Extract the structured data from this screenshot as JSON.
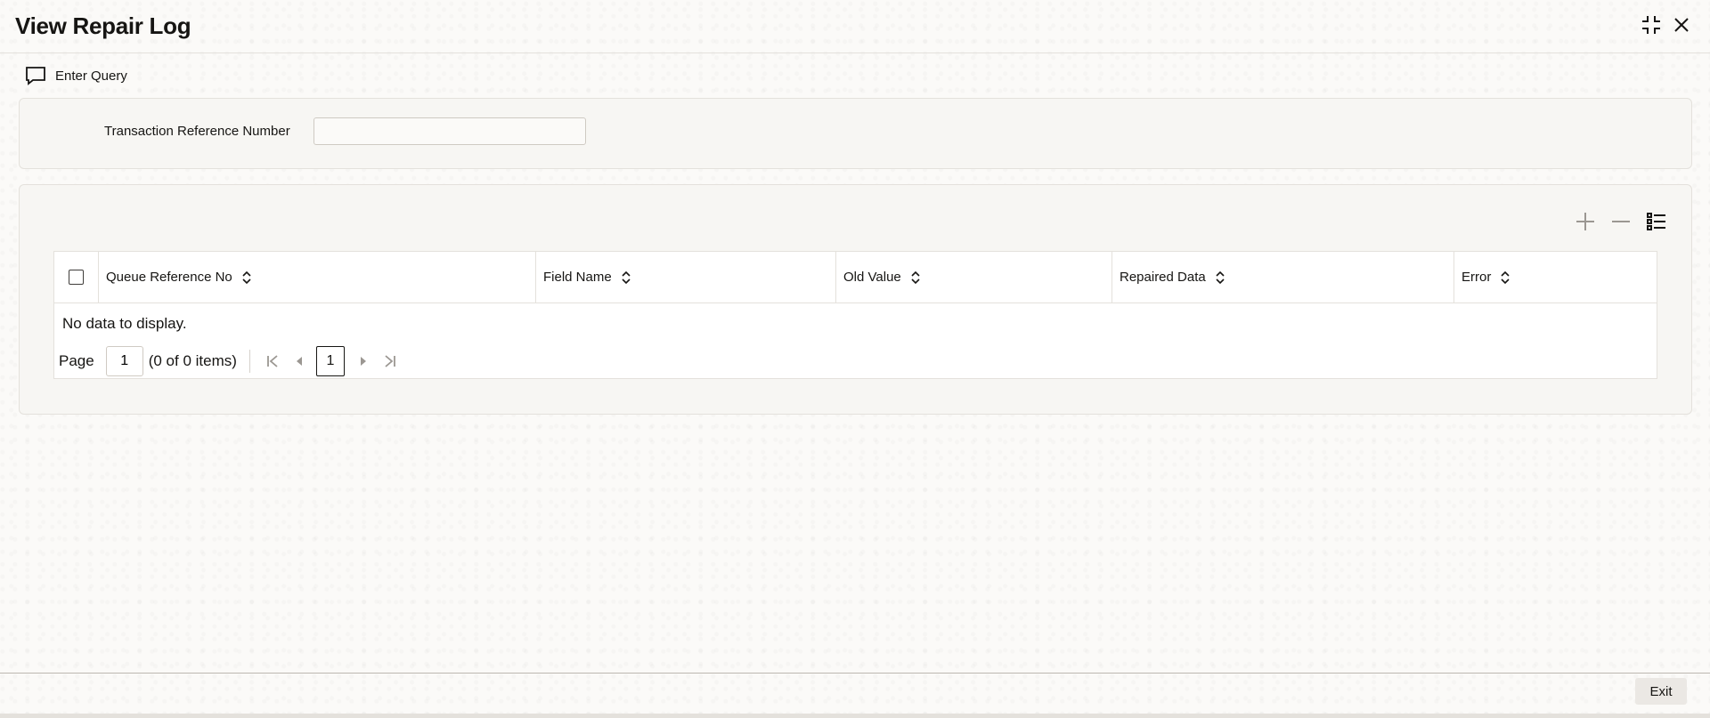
{
  "header": {
    "title": "View Repair Log",
    "maximize_icon": "collapse-icon",
    "close_icon": "close-icon"
  },
  "toolbar": {
    "enter_query_label": "Enter Query",
    "enter_query_icon": "chat-bubble-icon"
  },
  "query_form": {
    "transaction_reference_label": "Transaction Reference Number",
    "transaction_reference_value": ""
  },
  "grid": {
    "tools": [
      "add-icon",
      "remove-icon",
      "list-icon"
    ],
    "columns": [
      {
        "label": "Queue Reference No"
      },
      {
        "label": "Field Name"
      },
      {
        "label": "Old Value"
      },
      {
        "label": "Repaired Data"
      },
      {
        "label": "Error"
      }
    ],
    "rows": [],
    "empty_message": "No data to display."
  },
  "pagination": {
    "page_label": "Page",
    "page_value": "1",
    "items_text": "(0 of 0 items)",
    "current_page": "1"
  },
  "footer": {
    "exit_label": "Exit"
  },
  "colors": {
    "text": "#161513",
    "background": "#fbfaf8",
    "panel": "#f7f6f3",
    "border": "#e4e1dc"
  }
}
